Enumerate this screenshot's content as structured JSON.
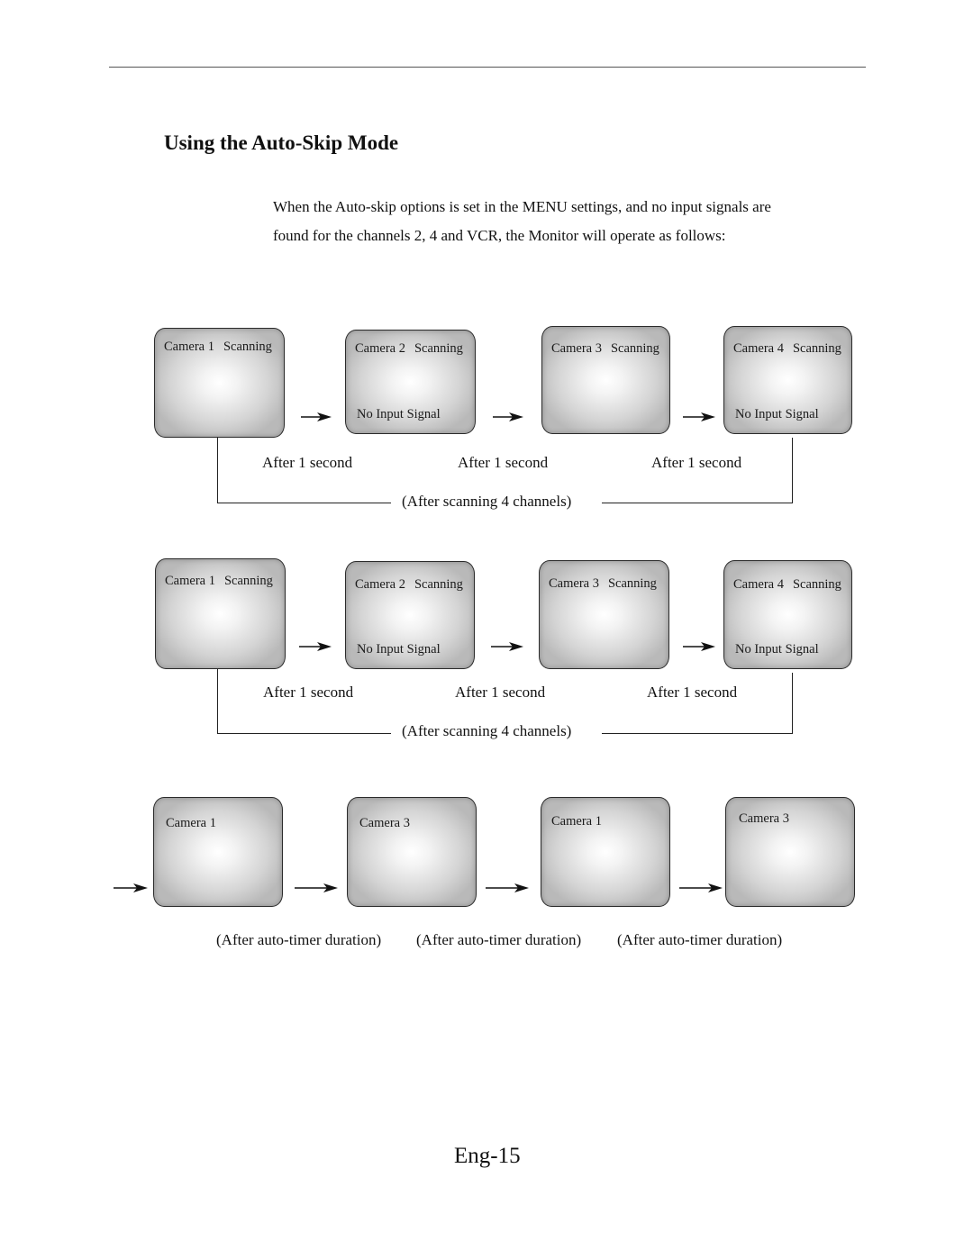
{
  "section": {
    "title": "Using the Auto-Skip Mode",
    "intro_line1": "When the Auto-skip options is set in the MENU settings, and no input signals are",
    "intro_line2": "found for the channels 2, 4 and VCR, the Monitor will operate as follows:"
  },
  "diagram1": {
    "monitors": [
      {
        "camera": "Camera 1",
        "status": "Scanning",
        "signal": ""
      },
      {
        "camera": "Camera 2",
        "status": "Scanning",
        "signal": "No Input Signal"
      },
      {
        "camera": "Camera 3",
        "status": "Scanning",
        "signal": ""
      },
      {
        "camera": "Camera 4",
        "status": "Scanning",
        "signal": "No Input Signal"
      }
    ],
    "step_labels": [
      "After 1 second",
      "After 1 second",
      "After 1 second"
    ],
    "loop_label": "(After scanning 4 channels)"
  },
  "diagram2": {
    "monitors": [
      {
        "camera": "Camera 1",
        "status": "Scanning",
        "signal": ""
      },
      {
        "camera": "Camera 2",
        "status": "Scanning",
        "signal": "No Input Signal"
      },
      {
        "camera": "Camera 3",
        "status": "Scanning",
        "signal": ""
      },
      {
        "camera": "Camera 4",
        "status": "Scanning",
        "signal": "No Input Signal"
      }
    ],
    "step_labels": [
      "After 1 second",
      "After 1 second",
      "After 1 second"
    ],
    "loop_label": "(After scanning 4 channels)"
  },
  "diagram3": {
    "monitors": [
      {
        "camera": "Camera 1"
      },
      {
        "camera": "Camera 3"
      },
      {
        "camera": "Camera 1"
      },
      {
        "camera": "Camera 3"
      }
    ],
    "step_labels": [
      "(After auto-timer duration)",
      "(After auto-timer duration)",
      "(After auto-timer duration)"
    ]
  },
  "footer": {
    "page_number": "Eng-15"
  },
  "icons": {
    "arrow": "right-arrow-icon"
  }
}
